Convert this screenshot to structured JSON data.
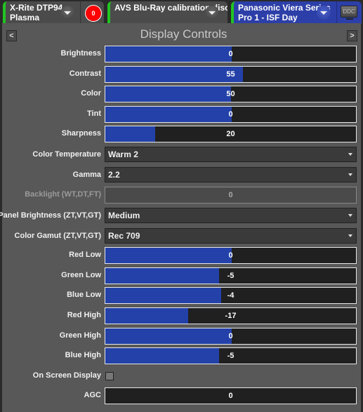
{
  "tabs": [
    {
      "label_line1": "X-Rite DTP94",
      "label_line2": "Plasma",
      "badge": "0"
    },
    {
      "label_line1": "AVS Blu-Ray calibration disc",
      "label_line2": ""
    },
    {
      "label_line1": "Panasonic Viera Series",
      "label_line2": "Pro 1 - ISF Day",
      "icon_label": "DDC"
    }
  ],
  "panel": {
    "title": "Display Controls",
    "prev_label": "<",
    "next_label": ">"
  },
  "controls": {
    "brightness": {
      "label": "Brightness",
      "value": "0",
      "fill": 0.505
    },
    "contrast": {
      "label": "Contrast",
      "value": "55",
      "fill": 0.55
    },
    "color": {
      "label": "Color",
      "value": "50",
      "fill": 0.5
    },
    "tint": {
      "label": "Tint",
      "value": "0",
      "fill": 0.505
    },
    "sharpness": {
      "label": "Sharpness",
      "value": "20",
      "fill": 0.2
    },
    "color_temperature": {
      "label": "Color Temperature",
      "value": "Warm 2"
    },
    "gamma": {
      "label": "Gamma",
      "value": "2.2"
    },
    "backlight": {
      "label": "Backlight (WT,DT,FT)",
      "value": "0"
    },
    "panel_brightness": {
      "label": "Panel Brightness (ZT,VT,GT)",
      "value": "Medium"
    },
    "color_gamut": {
      "label": "Color Gamut (ZT,VT,GT)",
      "value": "Rec 709"
    },
    "red_low": {
      "label": "Red Low",
      "value": "0",
      "fill": 0.505
    },
    "green_low": {
      "label": "Green Low",
      "value": "-5",
      "fill": 0.455
    },
    "blue_low": {
      "label": "Blue Low",
      "value": "-4",
      "fill": 0.462
    },
    "red_high": {
      "label": "Red High",
      "value": "-17",
      "fill": 0.33
    },
    "green_high": {
      "label": "Green High",
      "value": "0",
      "fill": 0.505
    },
    "blue_high": {
      "label": "Blue High",
      "value": "-5",
      "fill": 0.455
    },
    "on_screen_display": {
      "label": "On Screen Display",
      "checked": false
    },
    "agc": {
      "label": "AGC",
      "value": "0"
    }
  }
}
